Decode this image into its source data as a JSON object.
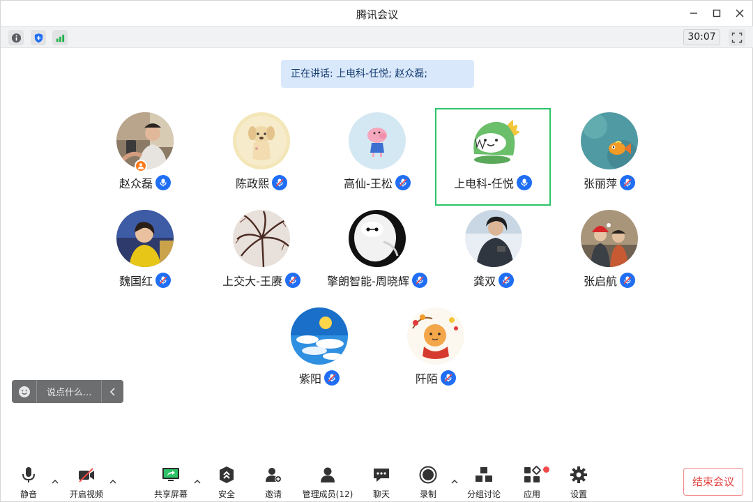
{
  "window": {
    "title": "腾讯会议"
  },
  "infobar": {
    "timer": "30:07",
    "icons": [
      "info-icon",
      "shield-icon",
      "signal-icon",
      "fullscreen-icon"
    ]
  },
  "speaking": {
    "text": "正在讲话: 上电科-任悦; 赵众磊;"
  },
  "participants": [
    {
      "name": "赵众磊",
      "mic": "on",
      "host": true
    },
    {
      "name": "陈政熙",
      "mic": "muted"
    },
    {
      "name": "高仙-王松",
      "mic": "muted"
    },
    {
      "name": "上电科-任悦",
      "mic": "on",
      "active": true
    },
    {
      "name": "张丽萍",
      "mic": "muted"
    },
    {
      "name": "魏国红",
      "mic": "muted"
    },
    {
      "name": "上交大-王赓",
      "mic": "muted"
    },
    {
      "name": "擎朗智能-周晓辉",
      "mic": "muted"
    },
    {
      "name": "龚双",
      "mic": "muted"
    },
    {
      "name": "张启航",
      "mic": "muted"
    },
    {
      "name": "紫阳",
      "mic": "muted"
    },
    {
      "name": "阡陌",
      "mic": "muted"
    }
  ],
  "chat": {
    "placeholder": "说点什么..."
  },
  "toolbar": {
    "mute": "静音",
    "video": "开启视频",
    "share": "共享屏幕",
    "security": "安全",
    "invite": "邀请",
    "members": "管理成员(12)",
    "chat": "聊天",
    "record": "录制",
    "breakout": "分组讨论",
    "apps": "应用",
    "settings": "设置",
    "end": "结束会议"
  },
  "colors": {
    "accent": "#1f6ef4",
    "active_border": "#2dc468",
    "end_text": "#e23b3b",
    "speaking_bg": "#d9e8fb"
  }
}
